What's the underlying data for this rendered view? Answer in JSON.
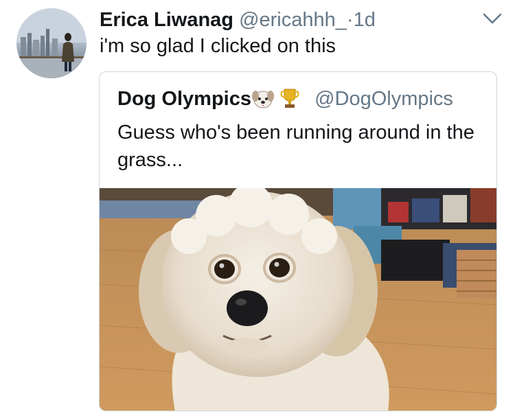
{
  "tweet": {
    "author_name": "Erica Liwanag",
    "handle": "@ericahhh_",
    "separator": "·",
    "time": "1d",
    "text": "i'm so glad I clicked on this",
    "avatar_icon": "profile-photo"
  },
  "menu": {
    "icon": "chevron-down-icon"
  },
  "quoted_tweet": {
    "author_name": "Dog Olympics",
    "emojis": [
      "dog-face-icon",
      "trophy-icon"
    ],
    "handle": "@DogOlympics",
    "text": "Guess who's been running around in the grass...",
    "media": "dog-photo"
  },
  "colors": {
    "text": "#14171a",
    "secondary": "#657786",
    "border": "#ccd6dd"
  }
}
